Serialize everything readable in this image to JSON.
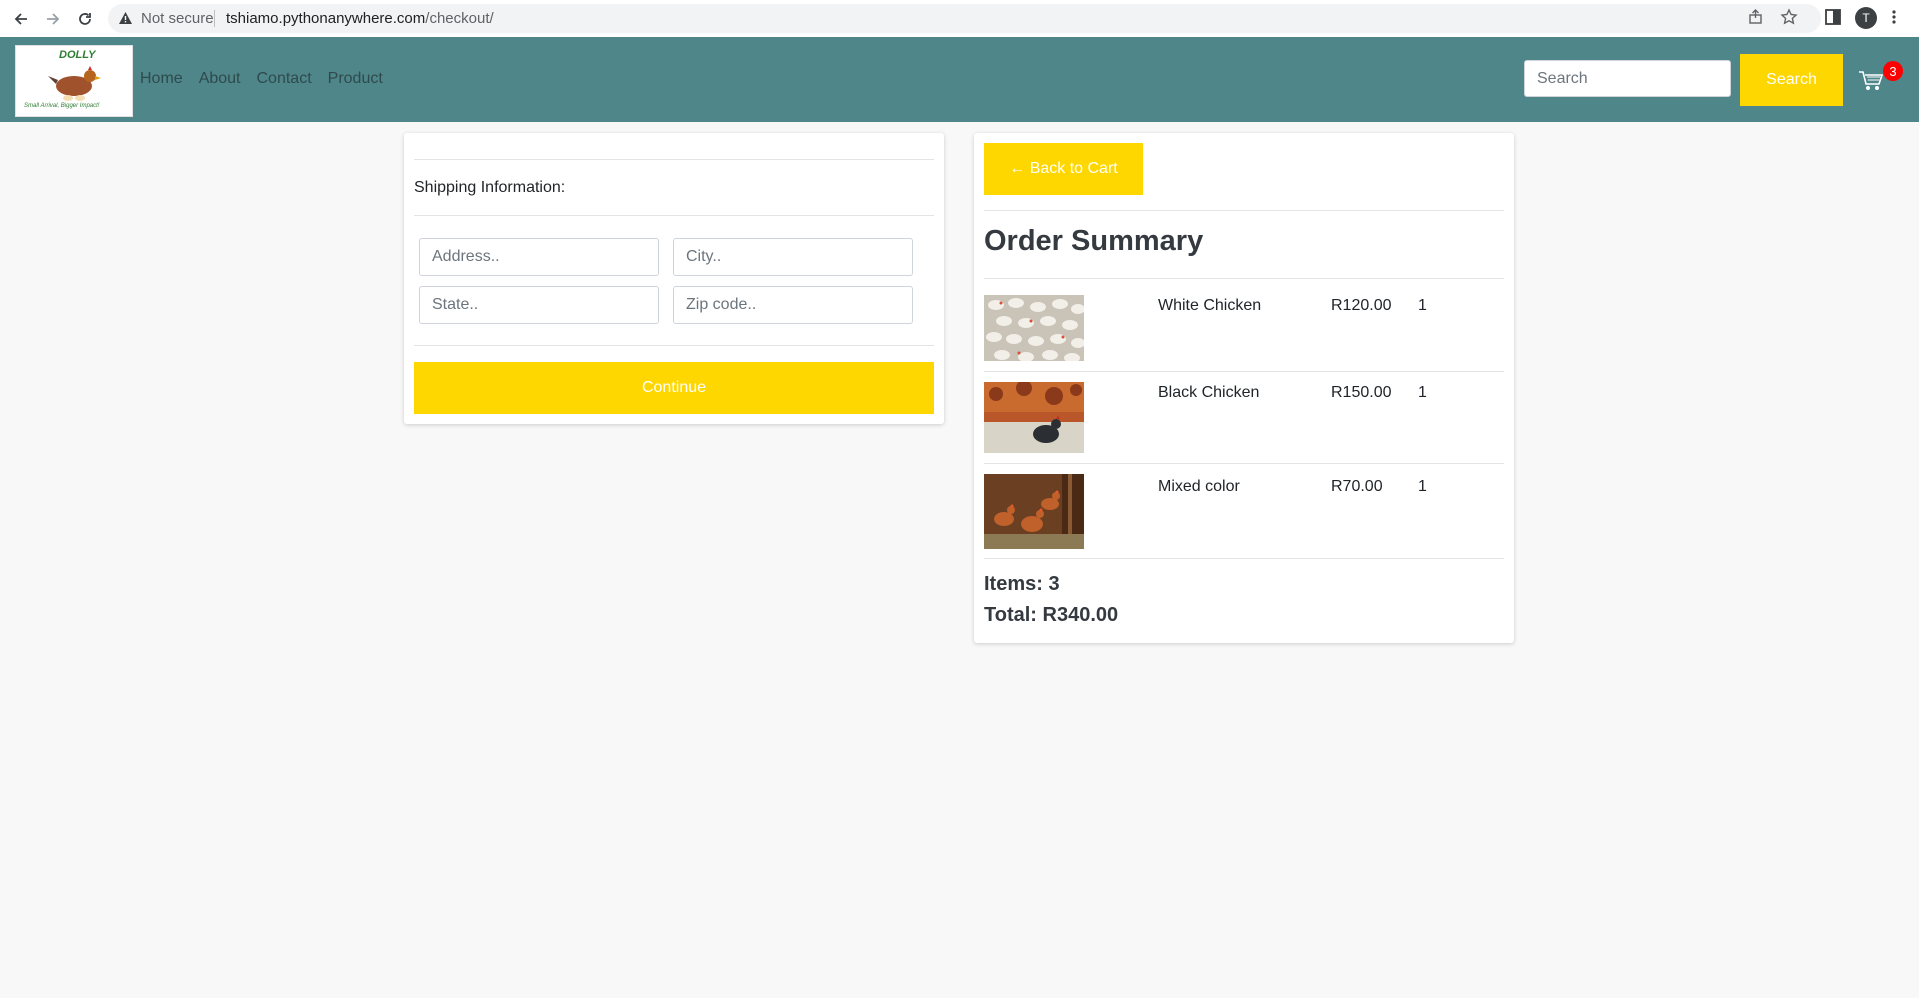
{
  "browser": {
    "security_label": "Not secure",
    "url_host": "tshiamo.pythonanywhere.com",
    "url_path": "/checkout/",
    "profile_initial": "T"
  },
  "navbar": {
    "logo_brand": "DOLLY",
    "logo_tagline": "Small Arrival, Bigger Impact!",
    "links": [
      "Home",
      "About",
      "Contact",
      "Product"
    ],
    "search_placeholder": "Search",
    "search_button": "Search",
    "cart_count": "3",
    "colors": {
      "bar": "#4f868a",
      "accent": "#ffd700",
      "badge": "#ff0000"
    }
  },
  "shipping": {
    "title": "Shipping Information:",
    "address_placeholder": "Address..",
    "city_placeholder": "City..",
    "state_placeholder": "State..",
    "zip_placeholder": "Zip code..",
    "continue_label": "Continue"
  },
  "summary": {
    "back_label": "← Back to Cart",
    "title": "Order Summary",
    "items": [
      {
        "name": "White Chicken",
        "price": "R120.00",
        "quantity": "1",
        "image": "white-chickens-photo"
      },
      {
        "name": "Black Chicken",
        "price": "R150.00",
        "quantity": "1",
        "image": "black-chicken-photo"
      },
      {
        "name": "Mixed color",
        "price": "R70.00",
        "quantity": "1",
        "image": "brown-chickens-photo"
      }
    ],
    "items_label": "Items: 3",
    "total_label": "Total: R340.00"
  }
}
